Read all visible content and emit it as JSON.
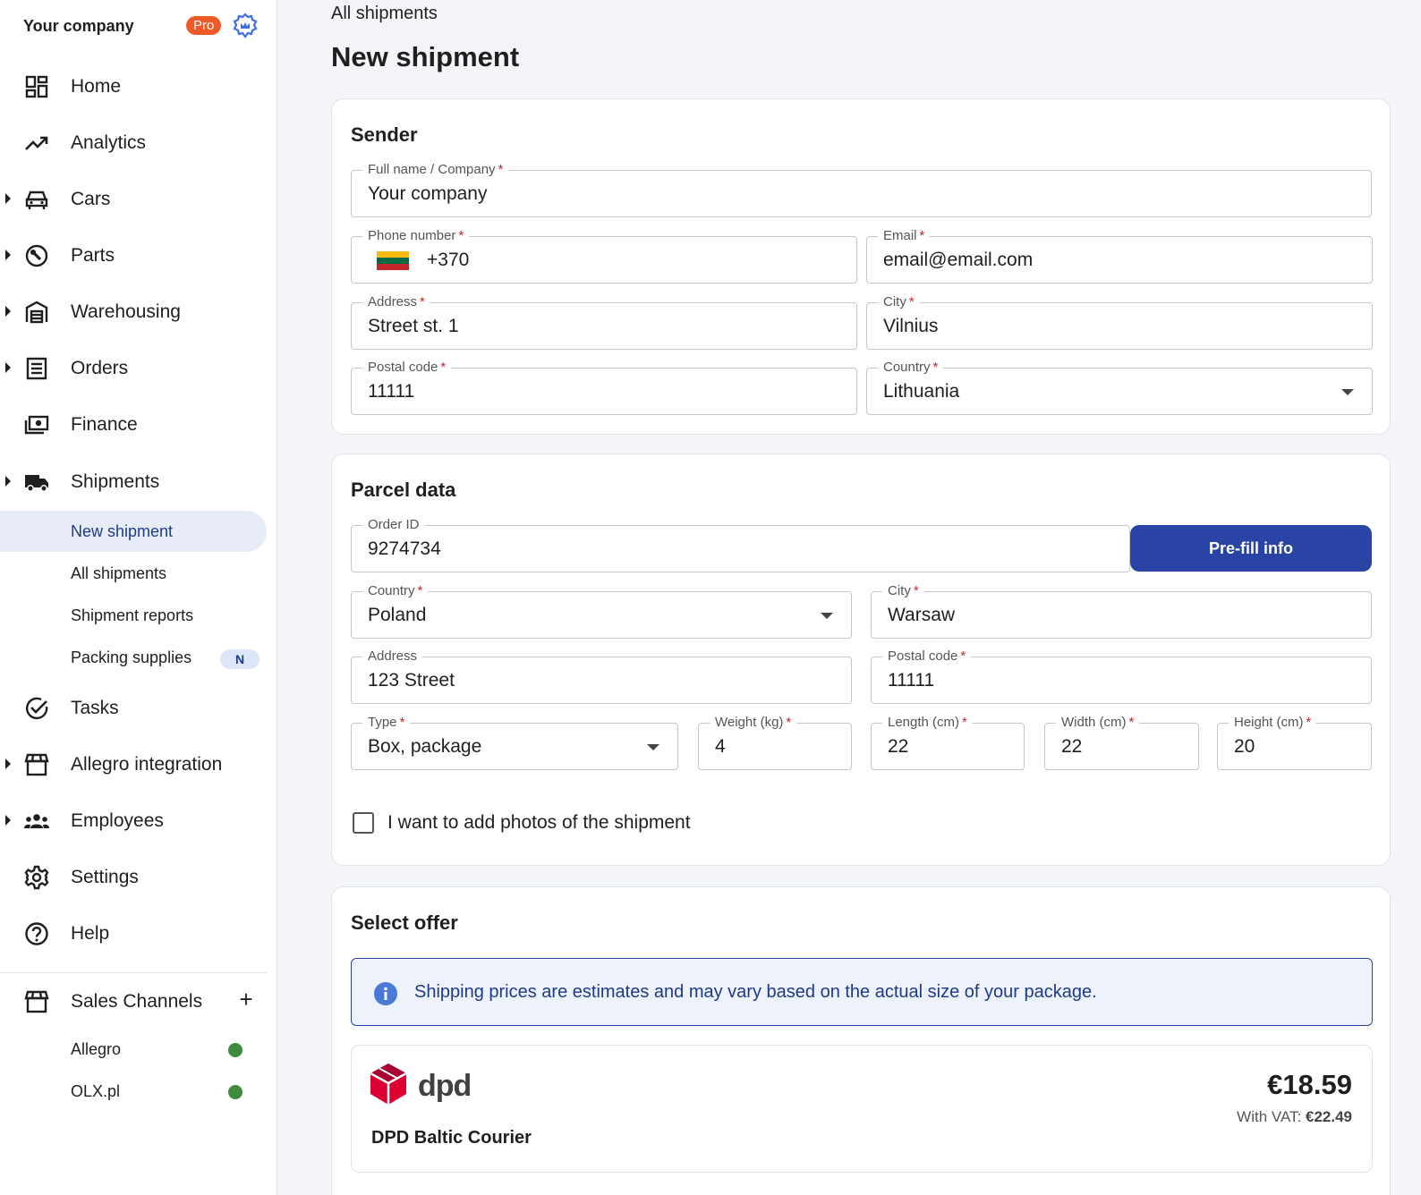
{
  "sidebar": {
    "brand_name": "Your company",
    "pro_badge": "Pro",
    "nav": [
      {
        "label": "Home",
        "icon": "dashboard-icon"
      },
      {
        "label": "Analytics",
        "icon": "trending-up-icon"
      },
      {
        "label": "Cars",
        "icon": "car-icon"
      },
      {
        "label": "Parts",
        "icon": "wrench-icon"
      },
      {
        "label": "Warehousing",
        "icon": "warehouse-icon"
      },
      {
        "label": "Orders",
        "icon": "receipt-icon"
      },
      {
        "label": "Finance",
        "icon": "payments-icon"
      },
      {
        "label": "Shipments",
        "icon": "truck-icon"
      }
    ],
    "shipments_sub": [
      {
        "label": "New shipment"
      },
      {
        "label": "All shipments"
      },
      {
        "label": "Shipment reports"
      },
      {
        "label": "Packing supplies",
        "badge": "N"
      }
    ],
    "nav2": [
      {
        "label": "Tasks",
        "icon": "task-check-icon"
      },
      {
        "label": "Allegro integration",
        "icon": "storefront-icon"
      },
      {
        "label": "Employees",
        "icon": "group-icon"
      },
      {
        "label": "Settings",
        "icon": "gear-icon"
      },
      {
        "label": "Help",
        "icon": "help-icon"
      }
    ],
    "sales_channels": {
      "label": "Sales Channels",
      "items": [
        {
          "label": "Allegro",
          "status_color": "#3e8a3e"
        },
        {
          "label": "OLX.pl",
          "status_color": "#3e8a3e"
        }
      ]
    }
  },
  "main": {
    "breadcrumb": "All shipments",
    "title": "New shipment",
    "sender": {
      "title": "Sender",
      "full_name": {
        "label": "Full name / Company",
        "value": "Your company"
      },
      "phone": {
        "label": "Phone number",
        "value": "+370"
      },
      "email": {
        "label": "Email",
        "value": "email@email.com"
      },
      "address": {
        "label": "Address",
        "value": "Street st. 1"
      },
      "city": {
        "label": "City",
        "value": "Vilnius"
      },
      "postal": {
        "label": "Postal code",
        "value": "11111"
      },
      "country": {
        "label": "Country",
        "value": "Lithuania"
      }
    },
    "parcel": {
      "title": "Parcel data",
      "order_id": {
        "label": "Order ID",
        "value": "9274734"
      },
      "prefill_label": "Pre-fill info",
      "country": {
        "label": "Country",
        "value": "Poland"
      },
      "city": {
        "label": "City",
        "value": "Warsaw"
      },
      "address": {
        "label": "Address",
        "value": "123 Street"
      },
      "postal": {
        "label": "Postal code",
        "value": "11111"
      },
      "type": {
        "label": "Type",
        "value": "Box, package"
      },
      "weight": {
        "label": "Weight (kg)",
        "value": "4"
      },
      "length": {
        "label": "Length (cm)",
        "value": "22"
      },
      "width": {
        "label": "Width (cm)",
        "value": "22"
      },
      "height": {
        "label": "Height (cm)",
        "value": "20"
      },
      "photos_label": "I want to add photos of the shipment"
    },
    "offer": {
      "title": "Select offer",
      "info": "Shipping prices are estimates and may vary based on the actual size of your package.",
      "item": {
        "carrier_logo": "dpd",
        "name": "DPD Baltic Courier",
        "price": "€18.59",
        "vat_label": "With VAT:",
        "vat_price": "€22.49"
      }
    }
  }
}
